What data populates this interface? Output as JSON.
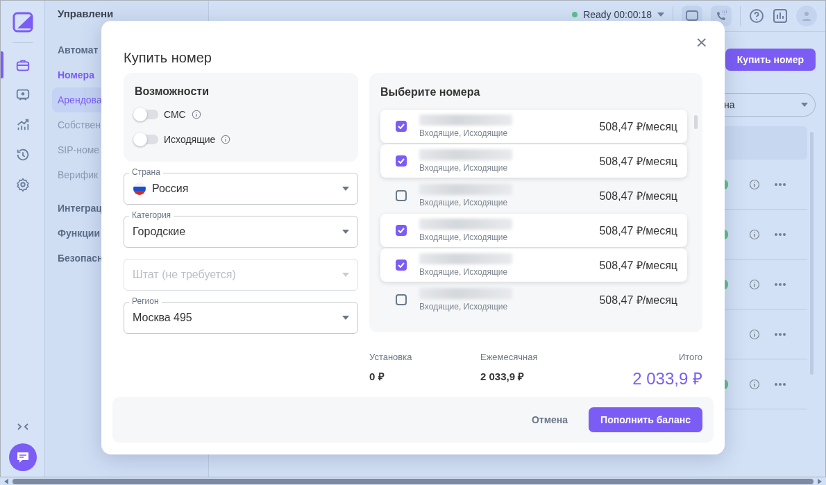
{
  "rail": {
    "items": [
      {
        "selected": true
      },
      {
        "selected": false
      },
      {
        "selected": false
      },
      {
        "selected": false
      },
      {
        "selected": false
      }
    ]
  },
  "sidebar": {
    "title": "Управлени",
    "items": [
      {
        "label": "Автомат",
        "kind": "group",
        "selected": false
      },
      {
        "label": "Номера",
        "kind": "group",
        "selected": true
      },
      {
        "label": "Арендова",
        "kind": "item",
        "selected": true
      },
      {
        "label": "Собствен",
        "kind": "item",
        "selected": false
      },
      {
        "label": "SIP-номе",
        "kind": "item",
        "selected": false
      },
      {
        "label": "Верифик",
        "kind": "item",
        "selected": false
      },
      {
        "label": "Интеграц",
        "kind": "group",
        "selected": false
      },
      {
        "label": "Функции",
        "kind": "group",
        "selected": false
      },
      {
        "label": "Безопасн",
        "kind": "group",
        "selected": false
      }
    ]
  },
  "topbar": {
    "status": "Ready 00:00:18"
  },
  "right_panel": {
    "buy_button": "Купить номер",
    "filter": {
      "value": "на"
    },
    "rows": [
      {
        "online": true
      },
      {
        "online": true
      },
      {
        "online": true
      },
      {
        "online": false
      },
      {
        "online": true
      }
    ]
  },
  "modal": {
    "title": "Купить номер",
    "close": "×",
    "capabilities": {
      "title": "Возможности",
      "toggles": [
        {
          "label": "СМС",
          "on": false
        },
        {
          "label": "Исходящие",
          "on": false
        }
      ]
    },
    "fields": [
      {
        "kind": "country",
        "label": "Страна",
        "value": "Россия",
        "disabled": false
      },
      {
        "kind": "select",
        "label": "Категория",
        "value": "Городские",
        "disabled": false
      },
      {
        "kind": "select",
        "placeholder": "Штат (не требуется)",
        "disabled": true
      },
      {
        "kind": "select",
        "label": "Регион",
        "value": "Москва 495",
        "disabled": false
      }
    ],
    "numbers": {
      "title": "Выберите номера",
      "rows": [
        {
          "checked": true,
          "features": "Входящие, Исходящие",
          "price": "508,47 ₽/месяц"
        },
        {
          "checked": true,
          "features": "Входящие, Исходящие",
          "price": "508,47 ₽/месяц"
        },
        {
          "checked": false,
          "features": "Входящие, Исходящие",
          "price": "508,47 ₽/месяц"
        },
        {
          "checked": true,
          "features": "Входящие, Исходящие",
          "price": "508,47 ₽/месяц"
        },
        {
          "checked": true,
          "features": "Входящие, Исходящие",
          "price": "508,47 ₽/месяц"
        },
        {
          "checked": false,
          "features": "Входящие, Исходящие",
          "price": "508,47 ₽/месяц"
        }
      ]
    },
    "totals": [
      {
        "kind": "plain",
        "label": "Установка",
        "value": "0 ₽"
      },
      {
        "kind": "plain",
        "label": "Ежемесячная",
        "value": "2 033,9 ₽"
      },
      {
        "kind": "total",
        "label": "Итого",
        "value": "2 033,9 ₽"
      }
    ],
    "cancel_button": "Отмена",
    "submit_button": "Пополнить баланс"
  }
}
